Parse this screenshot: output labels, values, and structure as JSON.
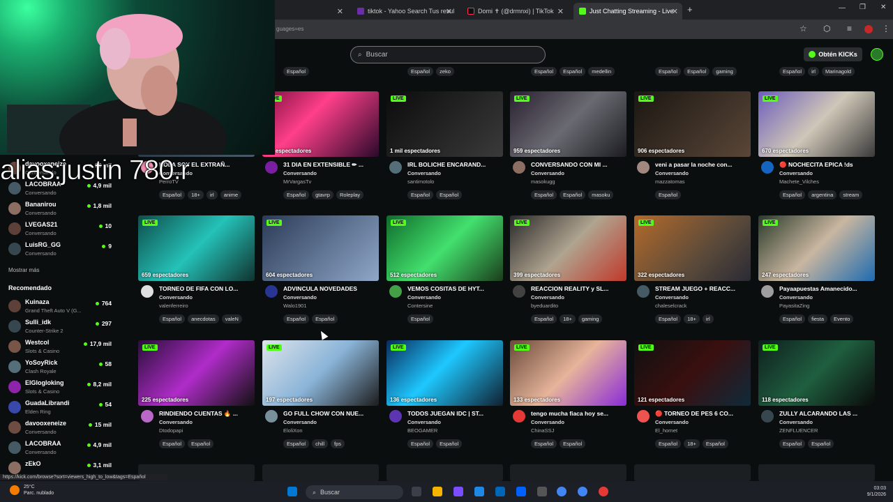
{
  "browser": {
    "tabs": [
      {
        "label": "tiktok - Yahoo Search Tus resul",
        "color": "#6b2ea8"
      },
      {
        "label": "Domi ✝ (@drmnxi) | TikTok",
        "color": "#111111"
      },
      {
        "label": "Just Chatting Streaming - Live",
        "color": "#53fc18"
      }
    ],
    "url": "guages=es",
    "status_url": "https://kick.com/browse?sort=viewers_high_to_low&tags=Español"
  },
  "overlay": {
    "alias_text": "alias:justin 780.r"
  },
  "header": {
    "search_placeholder": "Buscar",
    "get_kicks_label": "Obtén KICKs"
  },
  "top_row_tags": [
    [
      "Español"
    ],
    [
      "Español",
      "zeko"
    ],
    [
      "Español",
      "Español",
      "medellin"
    ],
    [
      "Español",
      "Español",
      "gaming"
    ],
    [
      "Español",
      "irl",
      "Marinagold"
    ]
  ],
  "sidebar": {
    "followed": [
      {
        "name": "davooxeneize",
        "category": "Conversando",
        "viewers": "15 mil"
      },
      {
        "name": "LACOBRAA",
        "category": "Conversando",
        "viewers": "4,9 mil"
      },
      {
        "name": "Bananirou",
        "category": "Conversando",
        "viewers": "1,8 mil"
      },
      {
        "name": "LVEGAS21",
        "category": "Conversando",
        "viewers": "10"
      },
      {
        "name": "LuisRG_GG",
        "category": "Conversando",
        "viewers": "9"
      }
    ],
    "show_more": "Mostrar más",
    "recommended_heading": "Recomendado",
    "recommended": [
      {
        "name": "Kuinaza",
        "category": "Grand Theft Auto V (G...",
        "viewers": "764"
      },
      {
        "name": "Sulli_idk",
        "category": "Counter-Strike 2",
        "viewers": "297"
      },
      {
        "name": "Westcol",
        "category": "Slots & Casino",
        "viewers": "17,9 mil"
      },
      {
        "name": "YoSoyRick",
        "category": "Clash Royale",
        "viewers": "58"
      },
      {
        "name": "ElGlogloking",
        "category": "Slots & Casino",
        "viewers": "8,2 mil"
      },
      {
        "name": "GuadaLibrandi",
        "category": "Elden Ring",
        "viewers": "54"
      },
      {
        "name": "davooxeneize",
        "category": "Conversando",
        "viewers": "15 mil"
      },
      {
        "name": "LACOBRAA",
        "category": "Conversando",
        "viewers": "4,9 mil"
      },
      {
        "name": "zEkO",
        "category": "",
        "viewers": "3,1 mil"
      }
    ]
  },
  "streams": [
    {
      "viewers": "mil espectadores",
      "title": "HOLA SOY EL EXTRAÑ...",
      "category": "Conversando",
      "channel": "PerroTV",
      "tags": [
        "Español",
        "18+",
        "irl",
        "anime"
      ]
    },
    {
      "viewers": "mil espectadores",
      "title": "31 DIA EN EXTENSIBLE ✏ ...",
      "category": "Conversando",
      "channel": "MrVargasTv",
      "tags": [
        "Español",
        "gtavrp",
        "Roleplay"
      ]
    },
    {
      "viewers": "1 mil espectadores",
      "title": "IRL BOLICHE ENCARAND...",
      "category": "Conversando",
      "channel": "santimotolo",
      "tags": [
        "Español",
        "Español"
      ]
    },
    {
      "viewers": "959 espectadores",
      "title": "CONVERSANDO CON MI ...",
      "category": "Conversando",
      "channel": "masokugg",
      "tags": [
        "Español",
        "Español",
        "masoku"
      ]
    },
    {
      "viewers": "906 espectadores",
      "title": "veni a pasar la noche con...",
      "category": "Conversando",
      "channel": "mazzatomas",
      "tags": [
        "Español"
      ]
    },
    {
      "viewers": "670 espectadores",
      "title": "🔴 NOCHECITA EPICA !ds",
      "category": "Conversando",
      "channel": "Machete_Vilches",
      "tags": [
        "Español",
        "argentina",
        "stream"
      ]
    },
    {
      "viewers": "659 espectadores",
      "title": "TORNEO DE FIFA CON LO...",
      "category": "Conversando",
      "channel": "valenferreiro",
      "tags": [
        "Español",
        "anecdotas",
        "valeN"
      ]
    },
    {
      "viewers": "604 espectadores",
      "title": "ADVINCULA NOVEDADES",
      "category": "Conversando",
      "channel": "Walo1901",
      "tags": [
        "Español",
        "Español"
      ]
    },
    {
      "viewers": "512 espectadores",
      "title": "VEMOS COSITAS DE HYT...",
      "category": "Conversando",
      "channel": "Contersine",
      "tags": [
        "Español"
      ]
    },
    {
      "viewers": "399 espectadores",
      "title": "REACCION REALITY y SL...",
      "category": "Conversando",
      "channel": "byeduardito",
      "tags": [
        "Español",
        "18+",
        "gaming"
      ]
    },
    {
      "viewers": "322 espectadores",
      "title": "STREAM JUEGO + REACC...",
      "category": "Conversando",
      "channel": "chaleselcrack",
      "tags": [
        "Español",
        "18+",
        "irl"
      ]
    },
    {
      "viewers": "247 espectadores",
      "title": "Payaapuestas Amanecido...",
      "category": "Conversando",
      "channel": "PayasitaZing",
      "tags": [
        "Español",
        "fiesta",
        "Evento"
      ]
    },
    {
      "viewers": "225 espectadores",
      "title": "RINDIENDO CUENTAS 🔥 ...",
      "category": "Conversando",
      "channel": "Dtodopapi",
      "tags": [
        "Español",
        "Español"
      ]
    },
    {
      "viewers": "197 espectadores",
      "title": "GO FULL CHOW CON NUE...",
      "category": "Conversando",
      "channel": "EloliXon",
      "tags": [
        "Español",
        "chill",
        "fps"
      ]
    },
    {
      "viewers": "136 espectadores",
      "title": "TODOS JUEGAN IDC | ST...",
      "category": "Conversando",
      "channel": "BEOGAMER",
      "tags": [
        "Español",
        "Español"
      ]
    },
    {
      "viewers": "133 espectadores",
      "title": "tengo mucha fiaca hoy se...",
      "category": "Conversando",
      "channel": "ChinaSSJ",
      "tags": [
        "Español",
        "Español"
      ]
    },
    {
      "viewers": "121 espectadores",
      "title": "🔴 TORNEO DE PES 6 CO...",
      "category": "Conversando",
      "channel": "El_hornet",
      "tags": [
        "Español",
        "18+",
        "Español"
      ]
    },
    {
      "viewers": "118 espectadores",
      "title": "ZULLY ALCARANDO LAS ...",
      "category": "Conversando",
      "channel": "ZENFLUENCER",
      "tags": [
        "Español",
        "Español"
      ]
    }
  ],
  "live_label": "LIVE",
  "taskbar": {
    "search_label": "Buscar",
    "weather_temp": "25°C",
    "weather_desc": "Parc. nublado",
    "time": "03:03",
    "date": "9/1/2026"
  },
  "colors": {
    "accent": "#53fc18",
    "bg": "#0b0e0f"
  }
}
